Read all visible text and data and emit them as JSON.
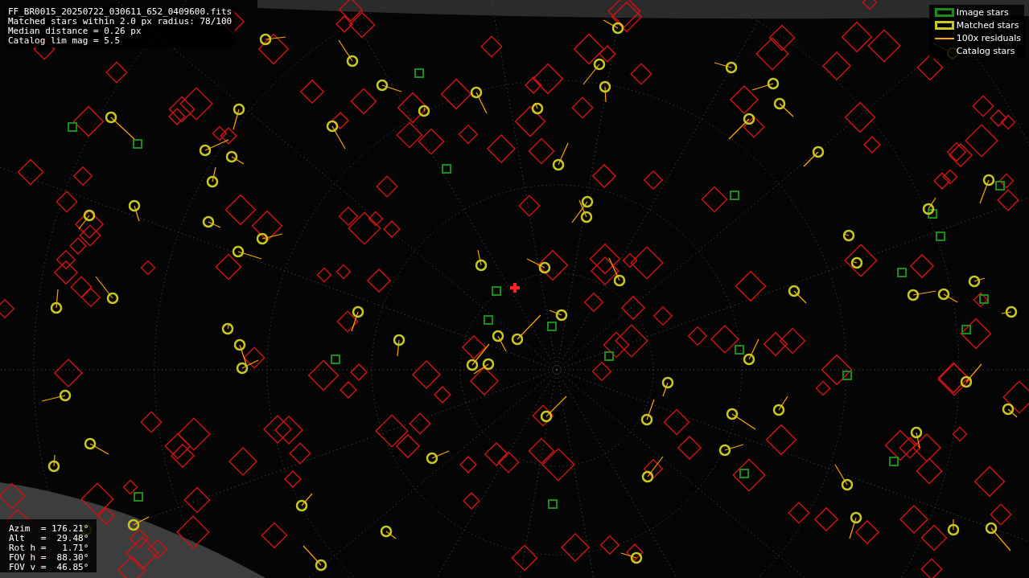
{
  "file_info": [
    "FF_BR0015_20250722_030611_652_0409600.fits",
    "Matched stars within 2.0 px radius: 78/100",
    "Median distance = 0.26 px",
    "Catalog lim mag = 5.5"
  ],
  "legend": [
    {
      "kind": "image",
      "label": "Image stars"
    },
    {
      "kind": "matched",
      "label": "Matched stars"
    },
    {
      "kind": "residual",
      "label": "100x residuals"
    },
    {
      "kind": "catalog",
      "label": "Catalog stars"
    }
  ],
  "pointing": [
    "Azim  = 176.21°",
    "Alt   =  29.48°",
    "Rot h =   1.71°",
    "FOV h =  88.30°",
    "FOV v =  46.85°"
  ]
}
